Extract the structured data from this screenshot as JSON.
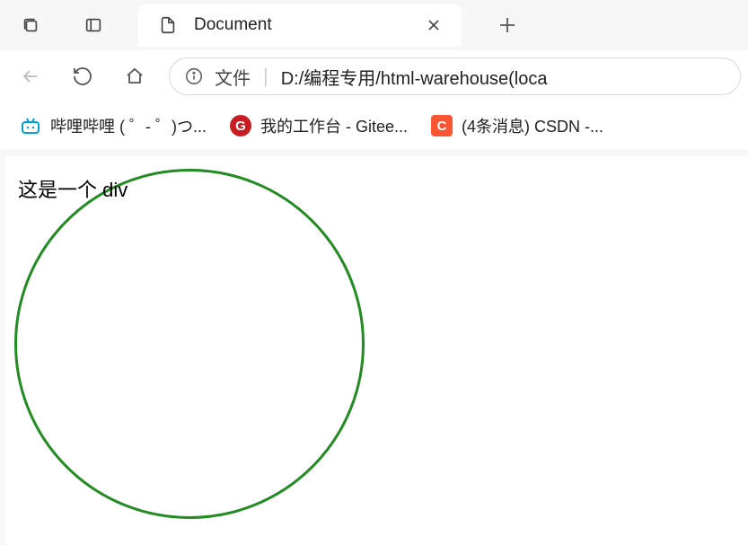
{
  "chrome": {
    "tab_title": "Document",
    "address": {
      "type_label": "文件",
      "url": "D:/编程专用/html-warehouse(loca"
    },
    "bookmarks": [
      {
        "icon": "bili",
        "label": "哔哩哔哩 ( ゜- ゜)つ..."
      },
      {
        "icon": "gitee",
        "glyph": "G",
        "label": "我的工作台 - Gitee..."
      },
      {
        "icon": "csdn",
        "glyph": "C",
        "label": "(4条消息) CSDN -..."
      }
    ]
  },
  "page": {
    "div_text": "这是一个 div"
  }
}
